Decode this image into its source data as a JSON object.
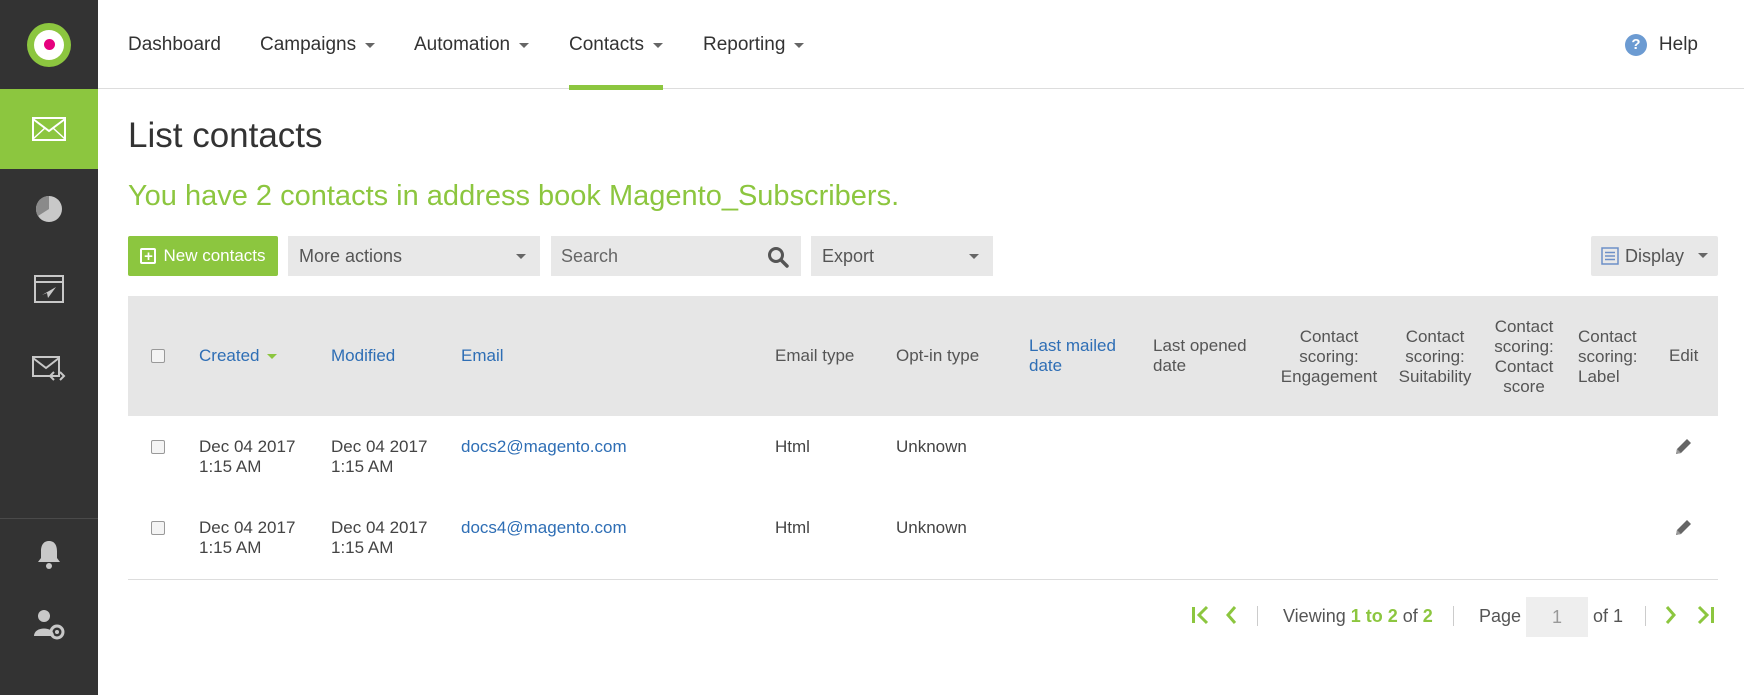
{
  "nav": {
    "items": [
      {
        "label": "Dashboard"
      },
      {
        "label": "Campaigns"
      },
      {
        "label": "Automation"
      },
      {
        "label": "Contacts"
      },
      {
        "label": "Reporting"
      }
    ],
    "active": "Contacts",
    "help_label": "Help"
  },
  "sidebar": {
    "items": [
      "email-icon",
      "chart-pie-icon",
      "browser-plane-icon",
      "email-code-icon"
    ],
    "bottom_items": [
      "bell-icon",
      "user-settings-icon"
    ],
    "active_color": "#8cc63f"
  },
  "page": {
    "title": "List contacts",
    "summary": "You have 2 contacts in address book Magento_Subscribers."
  },
  "toolbar": {
    "new_contacts_label": "New contacts",
    "more_actions_label": "More actions",
    "search_placeholder": "Search",
    "export_label": "Export",
    "display_label": "Display"
  },
  "table": {
    "headers": {
      "created": "Created",
      "modified": "Modified",
      "email": "Email",
      "email_type": "Email type",
      "optin_type": "Opt-in type",
      "last_mailed_1": "Last mailed",
      "last_mailed_2": "date",
      "last_opened_1": "Last opened",
      "last_opened_2": "date",
      "engagement_1": "Contact",
      "engagement_2": "scoring:",
      "engagement_3": "Engagement",
      "suitability_1": "Contact",
      "suitability_2": "scoring:",
      "suitability_3": "Suitability",
      "score_1": "Contact",
      "score_2": "scoring:",
      "score_3": "Contact",
      "score_4": "score",
      "label_1": "Contact",
      "label_2": "scoring:",
      "label_3": "Label",
      "edit": "Edit"
    },
    "rows": [
      {
        "created_date": "Dec 04 2017",
        "created_time": "1:15 AM",
        "modified_date": "Dec 04 2017",
        "modified_time": "1:15 AM",
        "email": "docs2@magento.com",
        "email_type": "Html",
        "optin_type": "Unknown"
      },
      {
        "created_date": "Dec 04 2017",
        "created_time": "1:15 AM",
        "modified_date": "Dec 04 2017",
        "modified_time": "1:15 AM",
        "email": "docs4@magento.com",
        "email_type": "Html",
        "optin_type": "Unknown"
      }
    ]
  },
  "pagination": {
    "viewing_prefix": "Viewing",
    "range": "1 to 2",
    "of_label": "of",
    "total": "2",
    "page_label": "Page",
    "page_value": "1",
    "of_pages": "of 1"
  },
  "colors": {
    "accent": "#8cc63f",
    "link": "#2e6eb5",
    "sidebar": "#333333"
  }
}
